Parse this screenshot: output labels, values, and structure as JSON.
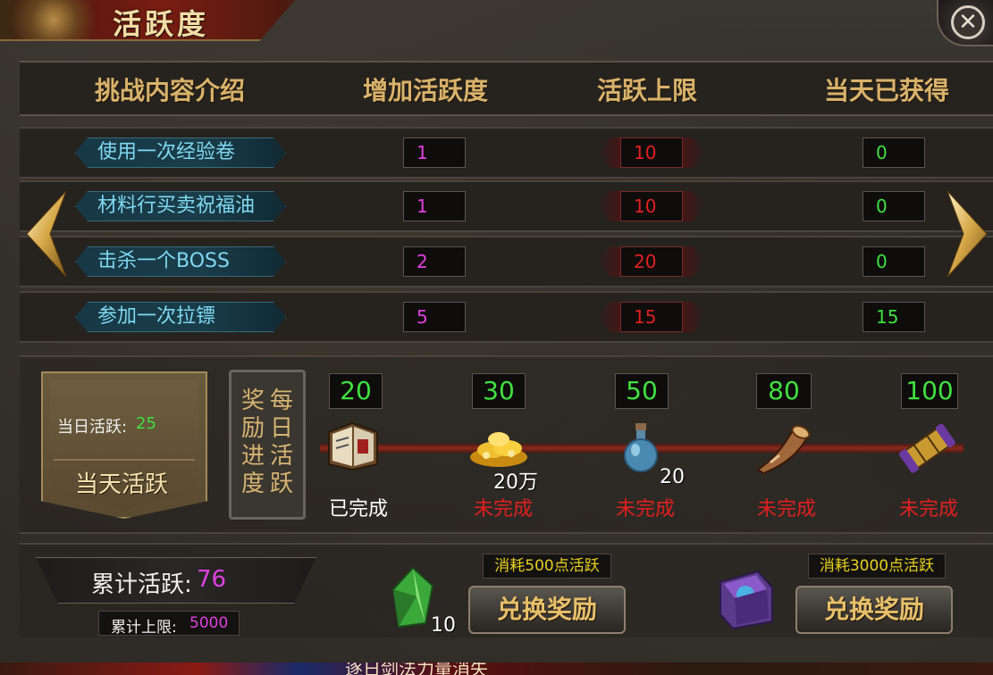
{
  "title": "活跃度",
  "headers": {
    "content": "挑战内容介绍",
    "add": "增加活跃度",
    "limit": "活跃上限",
    "today": "当天已获得"
  },
  "rows": [
    {
      "name": "使用一次经验卷",
      "add": "1",
      "limit": "10",
      "today": "0"
    },
    {
      "name": "材料行买卖祝福油",
      "add": "1",
      "limit": "10",
      "today": "0"
    },
    {
      "name": "击杀一个BOSS",
      "add": "2",
      "limit": "20",
      "today": "0"
    },
    {
      "name": "参加一次拉镖",
      "add": "5",
      "limit": "15",
      "today": "15"
    }
  ],
  "daily": {
    "label": "当日活跃:",
    "value": "25",
    "banner_title": "当天活跃"
  },
  "reward_tab": {
    "col1": "奖励进度",
    "col2": "每日活跃"
  },
  "milestones": [
    {
      "threshold": "20",
      "status": "已完成",
      "quantity": "",
      "icon": "book-icon",
      "completed": true
    },
    {
      "threshold": "30",
      "status": "未完成",
      "quantity": "20万",
      "icon": "gold-pile-icon",
      "completed": false
    },
    {
      "threshold": "50",
      "status": "未完成",
      "quantity": "20",
      "icon": "potion-icon",
      "completed": false
    },
    {
      "threshold": "80",
      "status": "未完成",
      "quantity": "",
      "icon": "horn-icon",
      "completed": false
    },
    {
      "threshold": "100",
      "status": "未完成",
      "quantity": "",
      "icon": "scroll-icon",
      "completed": false
    }
  ],
  "cumulative": {
    "label": "累计活跃:",
    "value": "76",
    "cap_label": "累计上限:",
    "cap_value": "5000"
  },
  "exchanges": [
    {
      "cost": "消耗500点活跃",
      "button": "兑换奖励",
      "icon": "green-crystal-icon",
      "quantity": "10"
    },
    {
      "cost": "消耗3000点活跃",
      "button": "兑换奖励",
      "icon": "skill-book-icon",
      "quantity": ""
    }
  ],
  "bottom_text": "逐日剑法力量消失",
  "colors": {
    "green": "#40e040",
    "magenta": "#e040e0",
    "red": "#e02020",
    "gold": "#d9b26a",
    "cyan": "#7fd8f0"
  }
}
